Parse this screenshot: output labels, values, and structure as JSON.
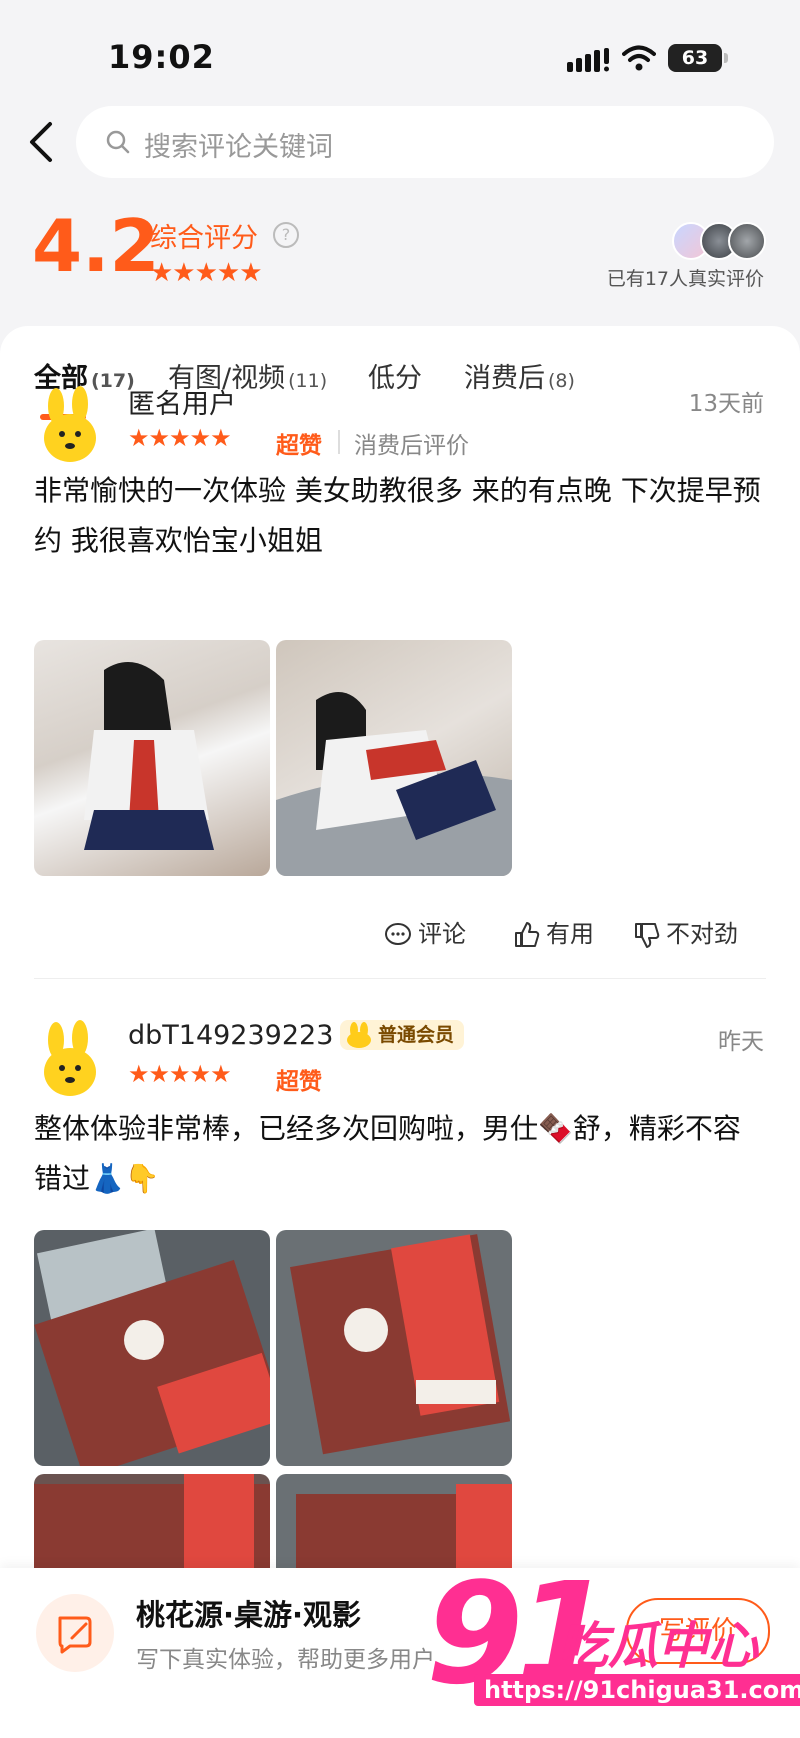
{
  "status_bar": {
    "time": "19:02",
    "battery": "63"
  },
  "search": {
    "placeholder": "搜索评论关键词"
  },
  "rating": {
    "score": "4.2",
    "label": "综合评分",
    "help": "?",
    "stars": "★★★★★",
    "real_reviews": "已有17人真实评价"
  },
  "tabs": [
    {
      "label": "全部",
      "count": "(17)"
    },
    {
      "label": "有图/视频",
      "count": "(11)"
    },
    {
      "label": "低分",
      "count": ""
    },
    {
      "label": "消费后",
      "count": "(8)"
    }
  ],
  "reviews": [
    {
      "user": "匿名用户",
      "time": "13天前",
      "stars": "★★★★★",
      "rating_text": "超赞",
      "tag": "消费后评价",
      "text": "非常愉快的一次体验 美女助教很多 来的有点晚 下次提早预约 我很喜欢怡宝小姐姐",
      "actions": {
        "comment": "评论",
        "useful": "有用",
        "wrong": "不对劲"
      }
    },
    {
      "user": "dbT149239223",
      "badge": "普通会员",
      "time": "昨天",
      "stars": "★★★★★",
      "rating_text": "超赞",
      "text": "整体体验非常棒，已经多次回购啦，男仕🍫舒，精彩不容错过👗👇"
    }
  ],
  "bottom_bar": {
    "shop_name": "桃花源·桌游·观影",
    "hint": "写下真实体验，帮助更多用户",
    "button": "写评价"
  },
  "watermark": {
    "number": "91",
    "text": "吃瓜中心",
    "url": "https://91chigua31.com"
  },
  "colors": {
    "accent": "#ff5b1a",
    "watermark": "#ff2f92"
  }
}
